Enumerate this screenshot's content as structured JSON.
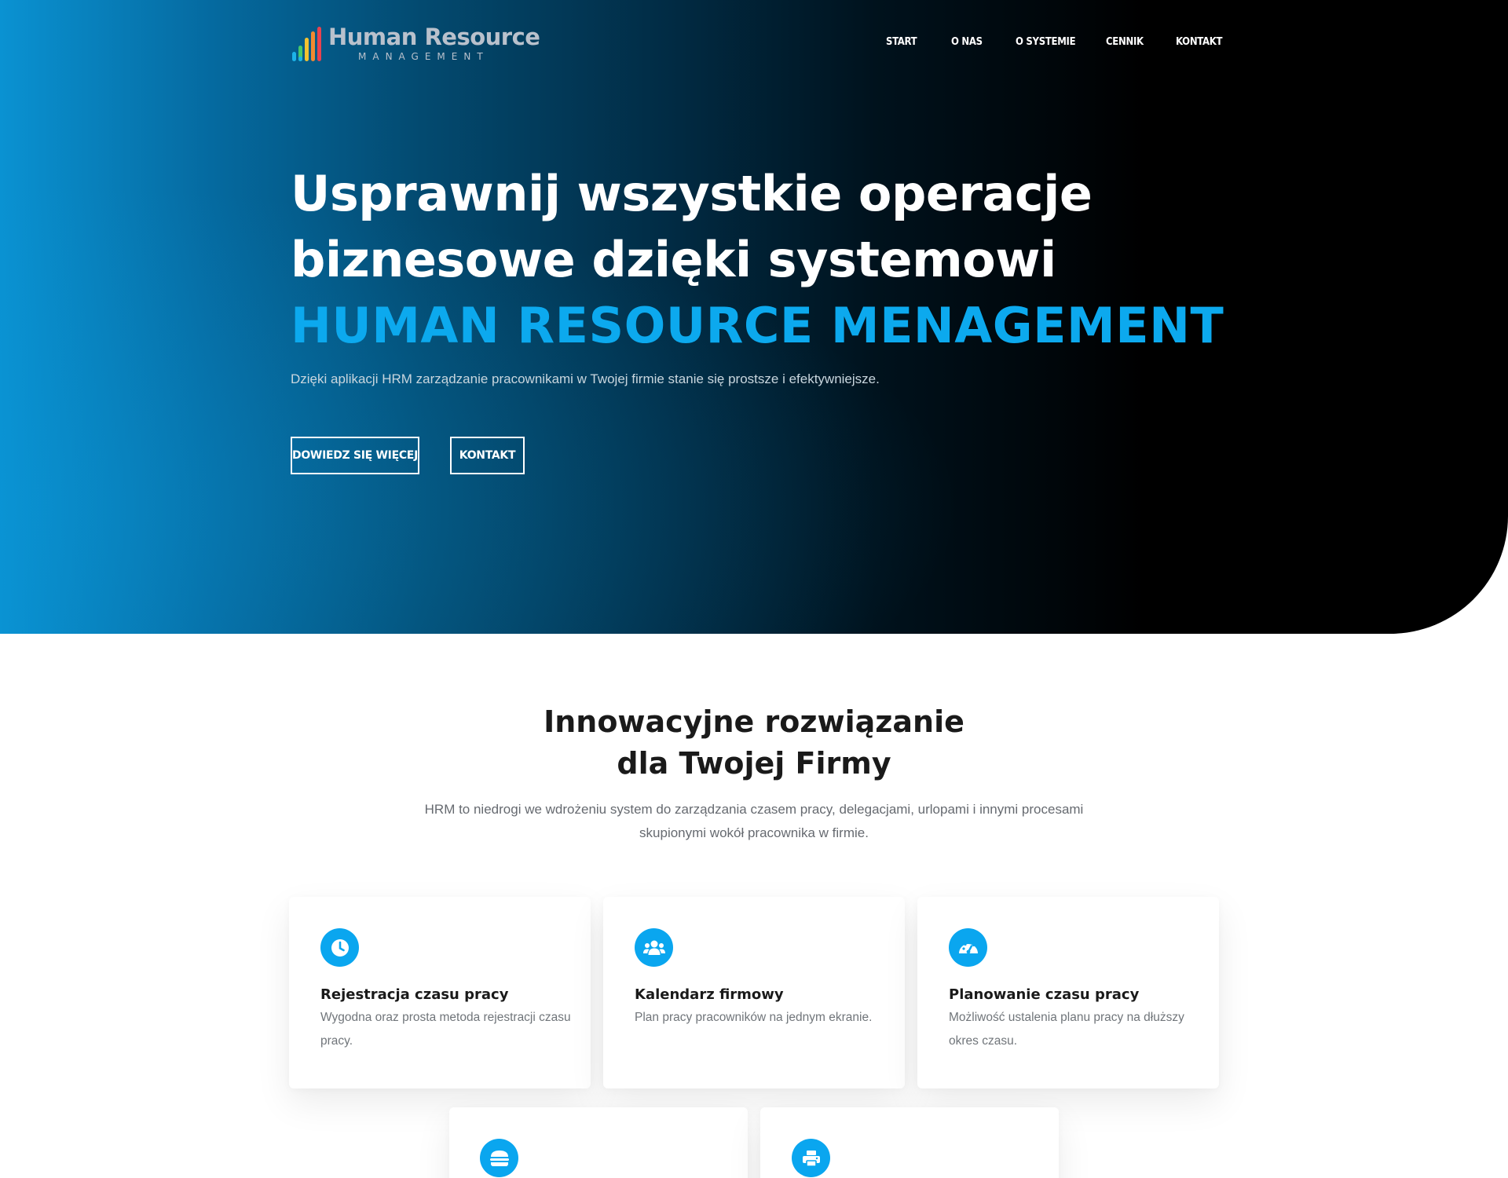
{
  "header": {
    "logo_title": "Human Resource",
    "logo_subtitle": "MANAGEMENT",
    "nav": [
      "START",
      "O NAS",
      "O SYSTEMIE",
      "CENNIK",
      "KONTAKT"
    ]
  },
  "hero": {
    "title_line1": "Usprawnij wszystkie operacje",
    "title_line2": "biznesowe dzięki systemowi",
    "title_accent": "HUMAN RESOURCE MENAGEMENT",
    "subtitle": "Dzięki aplikacji HRM zarządzanie pracownikami w Twojej firmie stanie się prostsze i efektywniejsze.",
    "btn_more": "DOWIEDZ SIĘ WIĘCEJ",
    "btn_contact": "KONTAKT"
  },
  "section": {
    "title_line1": "Innowacyjne rozwiązanie",
    "title_line2": "dla Twojej Firmy",
    "description": "HRM to niedrogi we wdrożeniu system do zarządzania czasem pracy, delegacjami, urlopami i innymi procesami skupionymi wokół pracownika w firmie."
  },
  "features": [
    {
      "icon": "clock-icon",
      "title": "Rejestracja czasu pracy",
      "text": "Wygodna oraz prosta metoda rejestracji czasu pracy."
    },
    {
      "icon": "users-icon",
      "title": "Kalendarz firmowy",
      "text": "Plan pracy pracowników na jednym ekranie."
    },
    {
      "icon": "gauge-icon",
      "title": "Planowanie czasu pracy",
      "text": "Możliwość ustalenia planu pracy na dłuższy okres czasu."
    },
    {
      "icon": "burger-icon",
      "title": "",
      "text": ""
    },
    {
      "icon": "printer-icon",
      "title": "",
      "text": ""
    }
  ],
  "colors": {
    "accent": "#0ca9ee",
    "icon_bg": "#0aa6ef",
    "hero_dark": "#000000",
    "hero_blue": "#0a92d2"
  }
}
